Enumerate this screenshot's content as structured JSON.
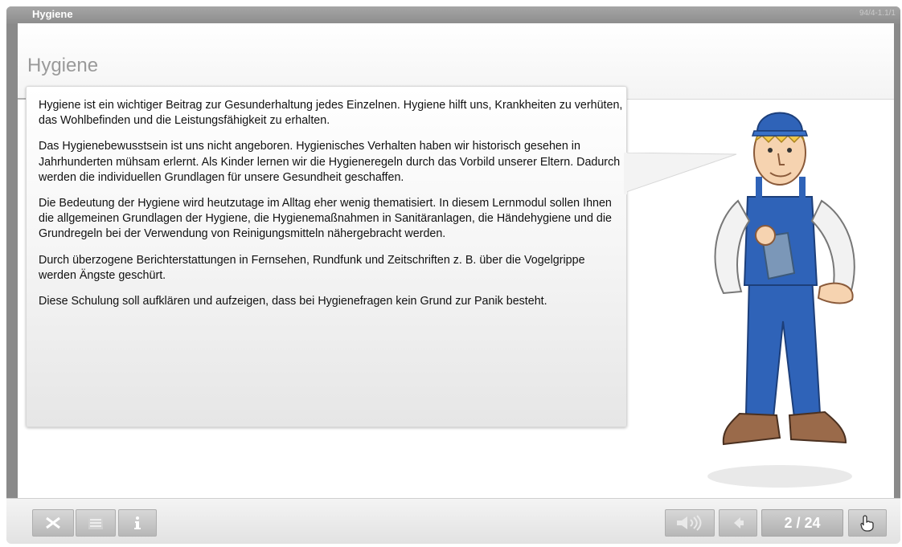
{
  "window": {
    "title": "Hygiene",
    "page_code": "94/4-1.1/1"
  },
  "page": {
    "heading": "Hygiene"
  },
  "speech_bubble": {
    "paragraphs": [
      "Hygiene ist ein wichtiger Beitrag zur Gesunderhaltung jedes Einzelnen. Hygiene hilft uns, Krankheiten zu verhüten, das Wohlbefinden und die Leistungsfähigkeit zu erhalten.",
      "Das Hygienebewusstsein ist uns nicht angeboren. Hygienisches Verhalten haben wir historisch gesehen in Jahrhunderten mühsam erlernt. Als Kinder lernen wir die Hygieneregeln durch das Vorbild unserer Eltern. Dadurch werden die individuellen Grundlagen für unsere Gesundheit geschaffen.",
      "Die Bedeutung der Hygiene wird heutzutage im Alltag eher wenig thematisiert. In diesem Lernmodul sollen Ihnen die allgemeinen Grundlagen der Hygiene, die Hygienemaßnahmen in Sanitäranlagen, die Händehygiene und die Grundregeln bei der Verwendung von Reinigungsmitteln nähergebracht werden.",
      "Durch überzogene Berichterstattungen in Fernsehen, Rundfunk und Zeitschriften z. B. über die Vogelgrippe werden Ängste geschürt.",
      "Diese Schulung soll aufklären und aufzeigen, dass bei Hygienefragen kein Grund zur Panik besteht."
    ]
  },
  "toolbar": {
    "close_icon": "close-x-icon",
    "menu_icon": "list-menu-icon",
    "info_icon": "info-icon",
    "sound_icon": "speaker-icon",
    "prev_icon": "arrow-left-icon",
    "page_indicator": "2 / 24",
    "next_icon": "hand-pointer-icon"
  },
  "colors": {
    "frame": "#8a8a8a",
    "heading": "#9a9a9a",
    "button": "#c4c4c4",
    "overalls": "#2f63b8"
  }
}
